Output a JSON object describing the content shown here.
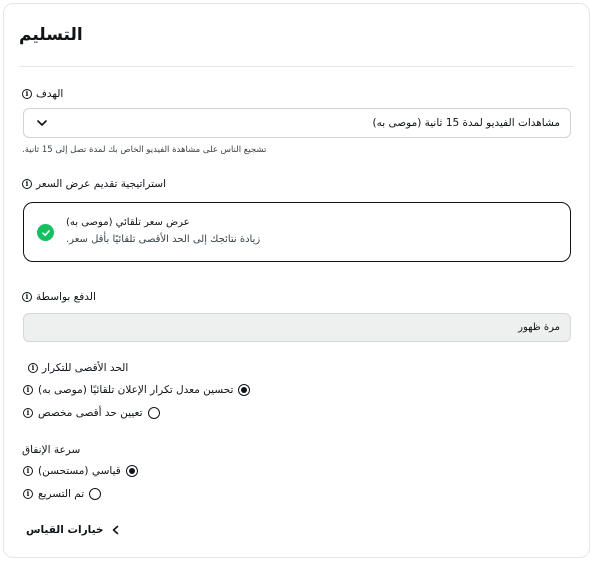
{
  "section": {
    "title": "التسليم"
  },
  "goal": {
    "label": "الهدف",
    "selected": "مشاهدات الفيديو لمدة 15 ثانية (موصى به)",
    "helper": "تشجيع الناس على مشاهدة الفيديو الخاص بك لمدة تصل إلى 15 ثانية."
  },
  "bid_strategy": {
    "label": "استراتيجية تقديم عرض السعر",
    "option_title": "عرض سعر تلقائي (موصى به)",
    "option_desc": "زيادة نتائجك إلى الحد الأقصى تلقائيًا بأقل سعر."
  },
  "pay_by": {
    "label": "الدفع بواسطة",
    "value": "مرة ظهور"
  },
  "frequency_cap": {
    "label": "الحد الأقصى للتكرار",
    "options": [
      {
        "label": "تحسين معدل تكرار الإعلان تلقائيًا (موصى به)",
        "selected": true
      },
      {
        "label": "تعيين حد أقصى مخصص",
        "selected": false
      }
    ]
  },
  "pacing": {
    "label": "سرعة الإنفاق",
    "options": [
      {
        "label": "قياسي (مستحسن)",
        "selected": true
      },
      {
        "label": "تم التسريع",
        "selected": false
      }
    ]
  },
  "measurement": {
    "label": "خيارات القياس"
  },
  "icons": {
    "info": "info-icon",
    "chevron": "chevron-down-icon",
    "check": "check-circle-icon",
    "expand": "chevron-left-icon"
  },
  "colors": {
    "accent_green": "#17bf63",
    "text": "#0f1419",
    "readonly_bg": "#eef0ef"
  }
}
